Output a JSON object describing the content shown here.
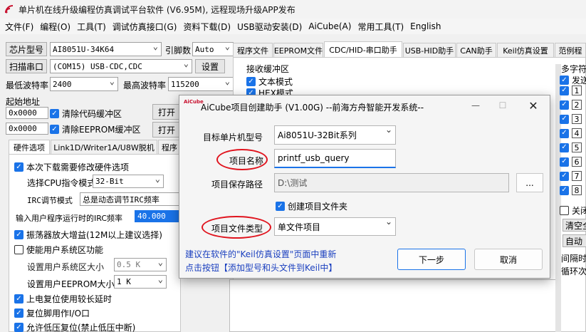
{
  "window": {
    "title": "单片机在线升级编程仿真调试平台软件 (V6.95M), 远程现场升级APP发布"
  },
  "menu": [
    "文件(F)",
    "编程(O)",
    "工具(T)",
    "调试仿真接口(G)",
    "资料下载(D)",
    "USB驱动安装(D)",
    "AiCube(A)",
    "常用工具(T)",
    "English"
  ],
  "left": {
    "chip_label": "芯片型号",
    "chip_value": "AI8051U-34K64",
    "pin_label": "引脚数",
    "pin_value": "Auto",
    "scan_button": "扫描串口",
    "port_value": "(COM15) USB-CDC,CDC",
    "settings_button": "设置",
    "min_baud_label": "最低波特率",
    "min_baud_value": "2400",
    "max_baud_label": "最高波特率",
    "max_baud_value": "115200",
    "start_addr_label": "起始地址",
    "addr1": "0x0000",
    "clear_code": "清除代码缓冲区",
    "open1": "打开",
    "addr2": "0x0000",
    "clear_eeprom": "清除EEPROM缓冲区",
    "open2": "打开",
    "tabs": [
      "硬件选项",
      "Link1D/Writer1A/U8W脱机",
      "程序"
    ],
    "hw": {
      "need_modify": "本次下载需要修改硬件选项",
      "cpu_mode_label": "选择CPU指令模式",
      "cpu_mode_value": "32-Bit",
      "irc_mode_label": "IRC调节模式",
      "irc_mode_value": "总是动态调节IRC频率",
      "irc_freq_label": "输入用户程序运行时的IRC频率",
      "irc_freq_value": "40.000",
      "osc_gain": "振荡器放大增益(12M以上建议选择)",
      "user_sys": "使能用户系统区功能",
      "sys_size_label": "设置用户系统区大小",
      "sys_size_value": "0.5 K",
      "eeprom_size_label": "设置用户EEPROM大小",
      "eeprom_size_value": "1 K",
      "power_delay": "上电复位使用较长延时",
      "reset_pin": "复位脚用作I/O口",
      "low_voltage": "允许低压复位(禁止低压中断)"
    }
  },
  "right": {
    "tabs": [
      "程序文件",
      "EEPROM文件",
      "CDC/HID-串口助手",
      "USB-HID助手",
      "CAN助手",
      "Keil仿真设置",
      "范例程"
    ],
    "recv_label": "接收缓冲区",
    "text_mode": "文本模式",
    "hex_mode": "HEX模式",
    "multi_label": "多字符",
    "send_label": "发送",
    "nums": [
      "1",
      "2",
      "3",
      "4",
      "5",
      "6",
      "7",
      "8"
    ],
    "close_label": "关闭",
    "clear_all": "清空全",
    "auto_label": "自动",
    "interval_label": "间隔时",
    "loop_label": "循环次"
  },
  "dialog": {
    "logo": "AiCube",
    "title": "AiCube项目创建助手 (V1.00G) --前海方舟智能开发系统--",
    "target_label": "目标单片机型号",
    "target_value": "Ai8051U-32Bit系列",
    "name_label": "项目名称",
    "name_value": "printf_usb_query",
    "path_label": "项目保存路径",
    "path_value": "D:\\测试",
    "browse": "...",
    "create_folder": "创建项目文件夹",
    "type_label": "项目文件类型",
    "type_value": "单文件项目",
    "note_line1": "建议在软件的\"Keil仿真设置\"页面中重新",
    "note_line2": "点击按钮【添加型号和头文件到Keil中】",
    "next": "下一步",
    "cancel": "取消"
  },
  "colors": {
    "accent": "#1a73e8",
    "highlight": "#e0141e",
    "link": "#1a3fbf"
  }
}
